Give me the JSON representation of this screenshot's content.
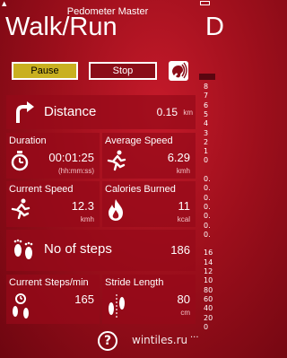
{
  "app": {
    "name": "Pedometer Master",
    "page_title": "Walk/Run",
    "next_page_initial": "D"
  },
  "controls": {
    "pause_label": "Pause",
    "stop_label": "Stop"
  },
  "stats": {
    "distance": {
      "label": "Distance",
      "value": "0.15",
      "unit": "km"
    },
    "duration": {
      "label": "Duration",
      "value": "00:01:25",
      "unit": "(hh:mm:ss)"
    },
    "average_speed": {
      "label": "Average Speed",
      "value": "6.29",
      "unit": "kmh"
    },
    "current_speed": {
      "label": "Current Speed",
      "value": "12.3",
      "unit": "kmh"
    },
    "calories": {
      "label": "Calories Burned",
      "value": "11",
      "unit": "kcal"
    },
    "steps": {
      "label": "No of steps",
      "value": "186"
    },
    "steps_per_min": {
      "label": "Current Steps/min",
      "value": "165"
    },
    "stride": {
      "label": "Stride Length",
      "value": "80",
      "unit": "cm"
    }
  },
  "side_panel": {
    "numbers": [
      "8",
      "7",
      "6",
      "5",
      "4",
      "3",
      "2",
      "1",
      "0",
      "",
      "0.",
      "0.",
      "0.",
      "0.",
      "0.",
      "0.",
      "0.",
      "",
      "16",
      "14",
      "12",
      "10",
      "80",
      "60",
      "40",
      "20",
      "0"
    ]
  },
  "footer": {
    "help_label": "?",
    "watermark": "wintiles.ru",
    "more_label": "..."
  },
  "colors": {
    "background": "#a3101e",
    "pause": "#c9b020",
    "stop": "#8a0d18"
  }
}
